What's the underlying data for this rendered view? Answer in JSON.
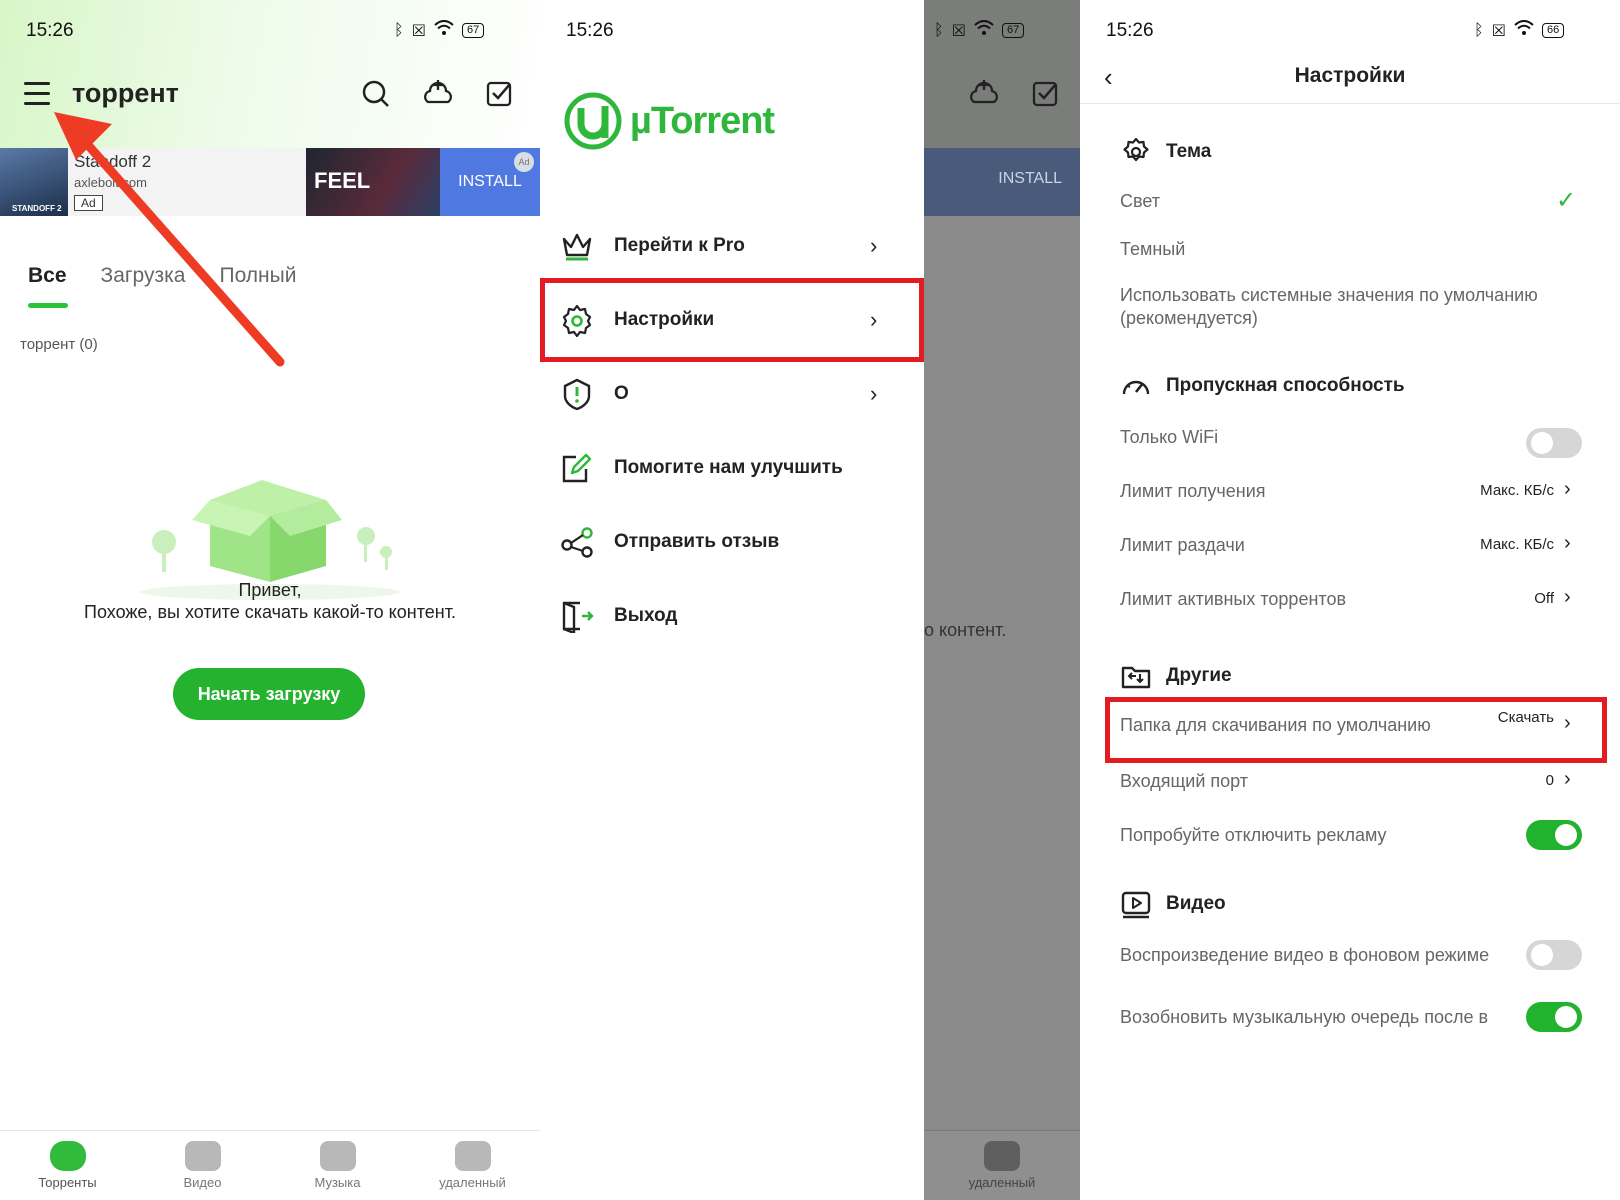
{
  "status": {
    "time1": "15:26",
    "battery1": "67",
    "time2": "15:26",
    "battery2": "67",
    "time3": "15:26",
    "battery3": "66"
  },
  "panel1": {
    "app_title": "торрент",
    "ad": {
      "title": "Standoff 2",
      "subtitle": "axlebolt.com",
      "badge": "Ad",
      "thumb_label": "STANDOFF 2",
      "game_text": "FEEL",
      "install": "INSTALL",
      "corner": "Ad"
    },
    "tabs": [
      "Все",
      "Загрузка",
      "Полный"
    ],
    "count_label": "торрент (0)",
    "empty_line1": "Привет,",
    "empty_line2": "Похоже, вы хотите скачать какой-то контент.",
    "start_button": "Начать загрузку",
    "nav": [
      "Торренты",
      "Видео",
      "Музыка",
      "удаленный"
    ]
  },
  "panel2": {
    "logo": "µTorrent",
    "menu": [
      {
        "label": "Перейти к Pro",
        "icon": "crown-icon",
        "chevron": "›"
      },
      {
        "label": "Настройки",
        "icon": "gear-icon",
        "chevron": "›"
      },
      {
        "label": "О",
        "icon": "info-shield-icon",
        "chevron": "›"
      },
      {
        "label": "Помогите нам улучшить",
        "icon": "edit-icon",
        "chevron": ""
      },
      {
        "label": "Отправить отзыв",
        "icon": "share-icon",
        "chevron": ""
      },
      {
        "label": "Выход",
        "icon": "exit-icon",
        "chevron": ""
      }
    ],
    "dim_install": "INSTALL",
    "dim_text": "о контент.",
    "dim_nav": "удаленный"
  },
  "panel3": {
    "title": "Настройки",
    "theme": {
      "header": "Тема",
      "light": "Свет",
      "dark": "Темный",
      "system": "Использовать системные значения по умолчанию (рекомендуется)"
    },
    "bandwidth": {
      "header": "Пропускная способность",
      "wifi_only": "Только WiFi",
      "wifi_only_on": false,
      "dl_limit": "Лимит получения",
      "dl_limit_value": "Макс. КБ/с",
      "ul_limit": "Лимит раздачи",
      "ul_limit_value": "Макс. КБ/с",
      "active_limit": "Лимит активных торрентов",
      "active_limit_value": "Off"
    },
    "other": {
      "header": "Другие",
      "folder": "Папка для скачивания по умолчанию",
      "folder_value": "Скачать",
      "port": "Входящий порт",
      "port_value": "0",
      "ads": "Попробуйте отключить рекламу",
      "ads_on": true
    },
    "video": {
      "header": "Видео",
      "bg_play": "Воспроизведение видео в фоновом режиме",
      "bg_play_on": false,
      "resume_music": "Возобновить музыкальную очередь после в",
      "resume_music_on": true
    }
  },
  "colors": {
    "accent": "#2fb73b",
    "highlight": "#e31b23",
    "arrow": "#ee3b24"
  }
}
